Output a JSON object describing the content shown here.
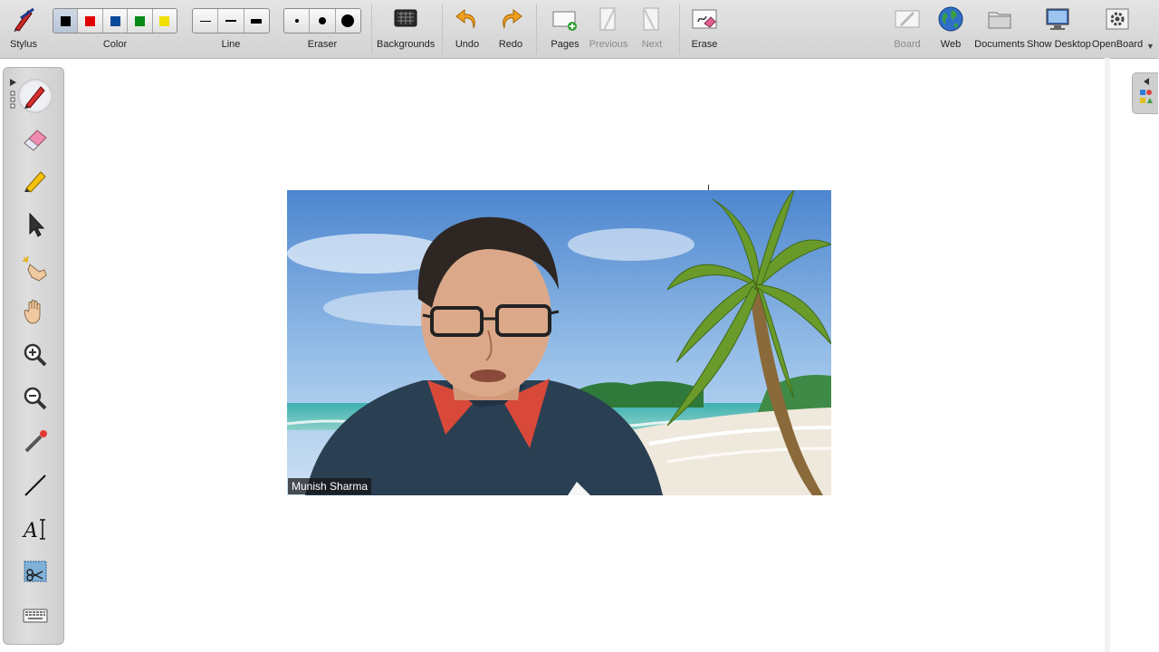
{
  "toolbar": {
    "stylus": "Stylus",
    "color": "Color",
    "line": "Line",
    "eraser": "Eraser",
    "backgrounds": "Backgrounds",
    "undo": "Undo",
    "redo": "Redo",
    "pages": "Pages",
    "previous": "Previous",
    "next": "Next",
    "erase": "Erase",
    "board": "Board",
    "web": "Web",
    "documents": "Documents",
    "show_desktop": "Show Desktop",
    "openboard": "OpenBoard"
  },
  "colors": {
    "swatches": [
      "#000000",
      "#e00000",
      "#0a4a9a",
      "#0a8a1a",
      "#f0e000"
    ],
    "selected_index": 0
  },
  "video": {
    "participant_name": "Munish Sharma"
  }
}
